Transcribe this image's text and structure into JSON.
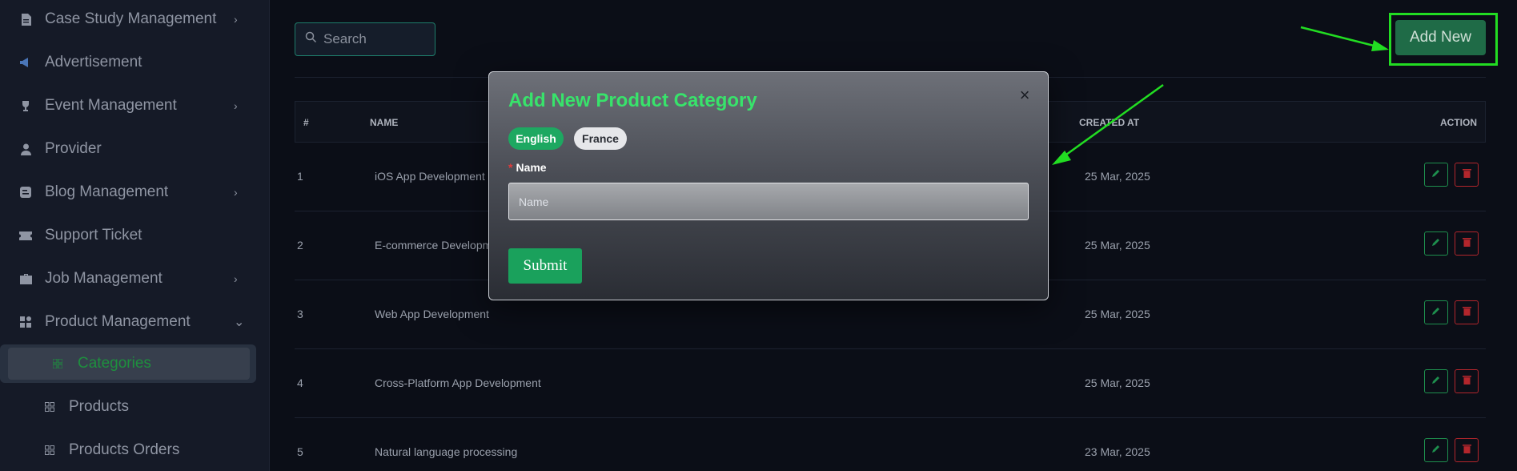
{
  "sidebar": {
    "items": [
      {
        "label": "Case Study Management",
        "icon": "document-icon",
        "chevron": "›"
      },
      {
        "label": "Advertisement",
        "icon": "megaphone-icon",
        "chevron": ""
      },
      {
        "label": "Event Management",
        "icon": "trophy-icon",
        "chevron": "›"
      },
      {
        "label": "Provider",
        "icon": "user-tie-icon",
        "chevron": ""
      },
      {
        "label": "Blog Management",
        "icon": "blog-icon",
        "chevron": "›"
      },
      {
        "label": "Support Ticket",
        "icon": "ticket-icon",
        "chevron": ""
      },
      {
        "label": "Job Management",
        "icon": "briefcase-icon",
        "chevron": "›"
      },
      {
        "label": "Product Management",
        "icon": "grid-icon",
        "chevron": "⌄"
      }
    ],
    "subitems": [
      {
        "label": "Categories",
        "icon": "grid-small-icon"
      },
      {
        "label": "Products",
        "icon": "grid-small-icon"
      },
      {
        "label": "Products Orders",
        "icon": "grid-small-icon"
      }
    ]
  },
  "search": {
    "placeholder": "Search"
  },
  "toolbar": {
    "add_new_label": "Add New"
  },
  "table": {
    "headers": {
      "index": "#",
      "name": "NAME",
      "created": "CREATED AT",
      "action": "ACTION"
    },
    "rows": [
      {
        "index": "1",
        "name": "iOS App Development",
        "created": "25 Mar, 2025"
      },
      {
        "index": "2",
        "name": "E-commerce Development",
        "created": "25 Mar, 2025"
      },
      {
        "index": "3",
        "name": "Web App Development",
        "created": "25 Mar, 2025"
      },
      {
        "index": "4",
        "name": "Cross-Platform App Development",
        "created": "25 Mar, 2025"
      },
      {
        "index": "5",
        "name": "Natural language processing",
        "created": "23 Mar, 2025"
      }
    ]
  },
  "modal": {
    "title": "Add New Product Category",
    "close": "×",
    "languages": [
      "English",
      "France"
    ],
    "name_label": "Name",
    "required_mark": "*",
    "name_placeholder": "Name",
    "submit_label": "Submit"
  },
  "colors": {
    "accent": "#1da861",
    "title_green": "#38e36b",
    "annotation": "#22dd22",
    "delete_red": "#b3262c"
  }
}
